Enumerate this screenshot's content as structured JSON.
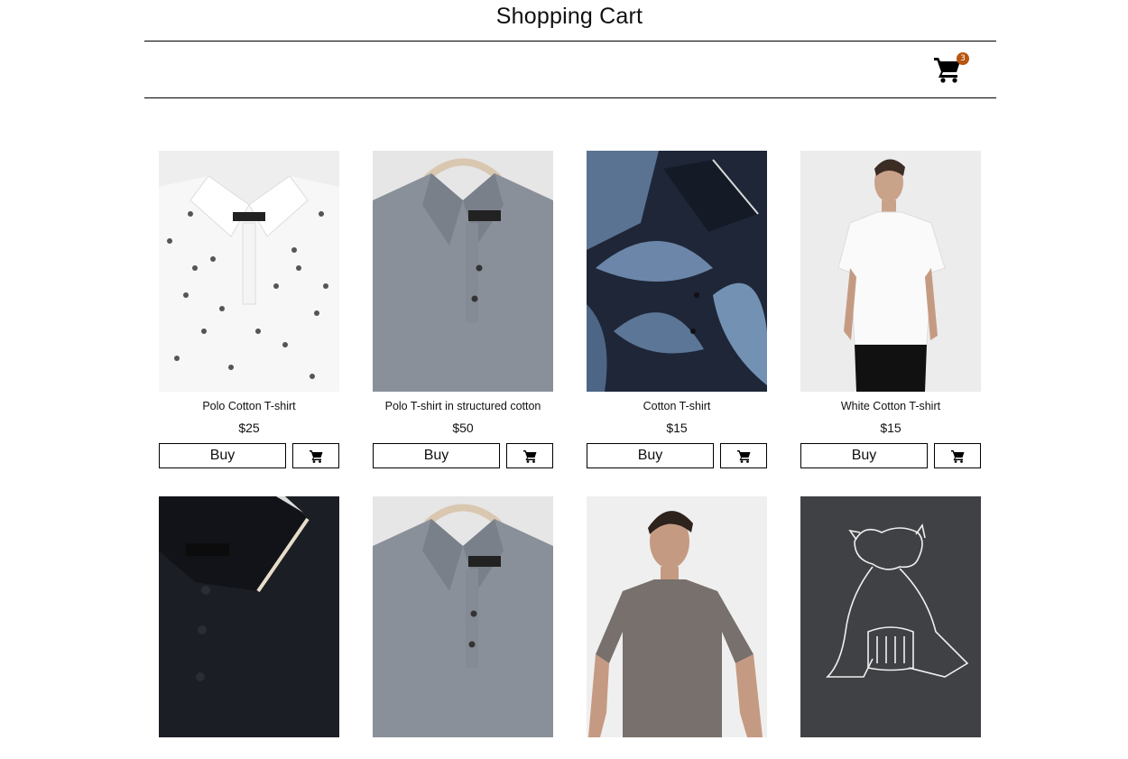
{
  "header": {
    "title": "Shopping Cart",
    "cart_count": "3"
  },
  "products": [
    {
      "name": "Polo Cotton T-shirt",
      "price": "$25",
      "buy_label": "Buy"
    },
    {
      "name": "Polo T-shirt in structured cotton",
      "price": "$50",
      "buy_label": "Buy"
    },
    {
      "name": "Cotton T-shirt",
      "price": "$15",
      "buy_label": "Buy"
    },
    {
      "name": "White Cotton T-shirt",
      "price": "$15",
      "buy_label": "Buy"
    },
    {
      "name": "",
      "price": "",
      "buy_label": ""
    },
    {
      "name": "",
      "price": "",
      "buy_label": ""
    },
    {
      "name": "",
      "price": "",
      "buy_label": ""
    },
    {
      "name": "",
      "price": "",
      "buy_label": ""
    }
  ],
  "colors": {
    "badge": "#b7560f",
    "border": "#000000"
  },
  "icons": {
    "cart": "shopping-cart-icon"
  }
}
